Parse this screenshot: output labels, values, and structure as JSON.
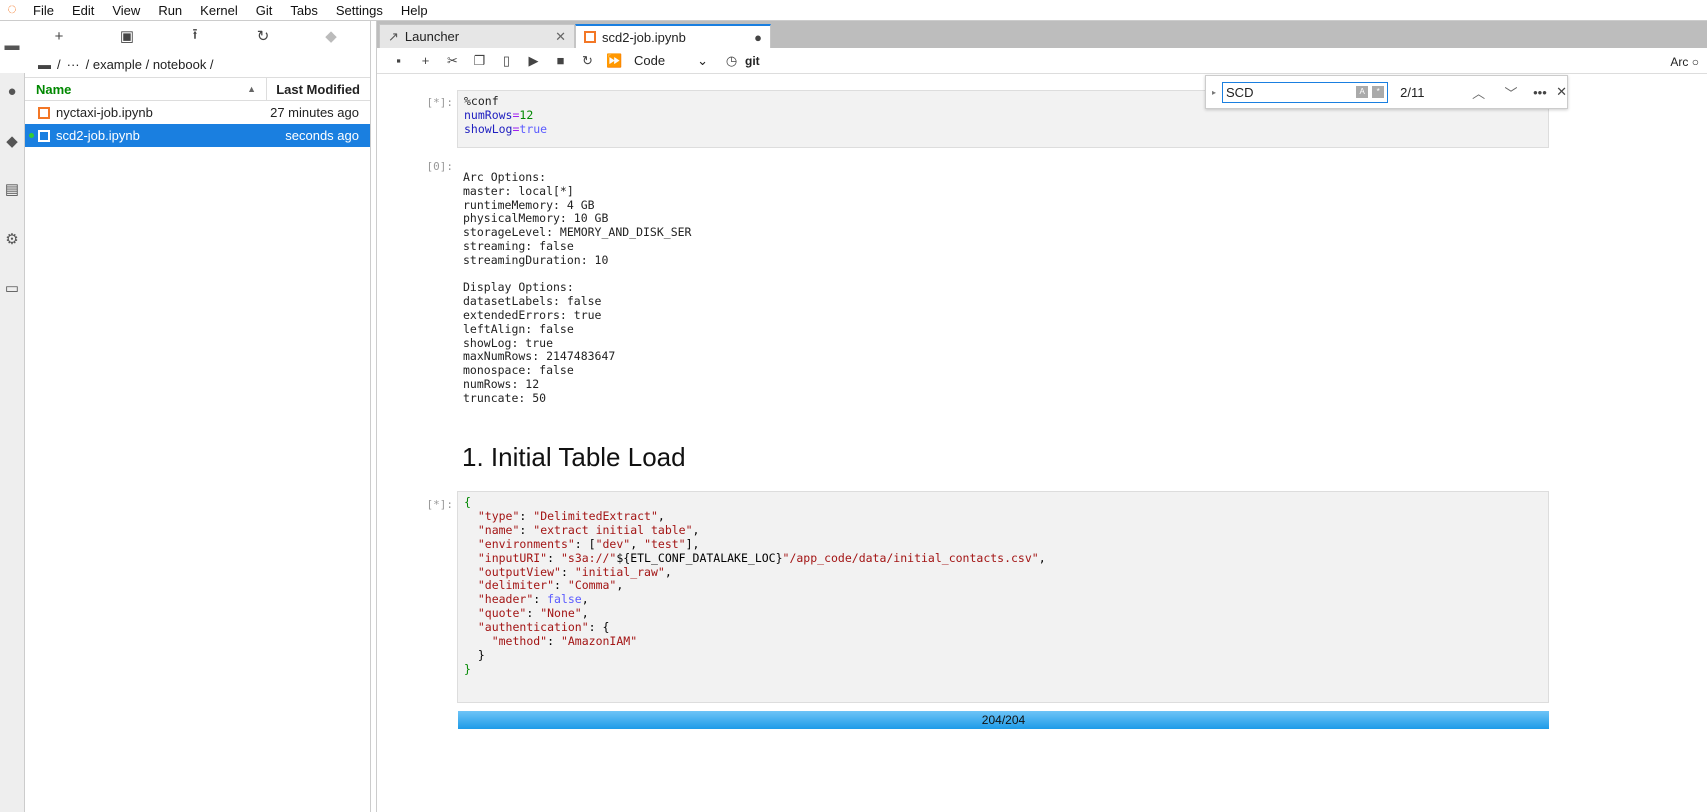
{
  "menubar": {
    "items": [
      "File",
      "Edit",
      "View",
      "Run",
      "Kernel",
      "Git",
      "Tabs",
      "Settings",
      "Help"
    ]
  },
  "filebrowser": {
    "breadcrumb": [
      "/",
      "···",
      "/ example / notebook /"
    ],
    "columns": {
      "name": "Name",
      "modified": "Last Modified"
    },
    "files": [
      {
        "name": "nyctaxi-job.ipynb",
        "modified": "27 minutes ago",
        "selected": false
      },
      {
        "name": "scd2-job.ipynb",
        "modified": "seconds ago",
        "selected": true
      }
    ]
  },
  "tabs": [
    {
      "label": "Launcher"
    },
    {
      "label": "scd2-job.ipynb"
    }
  ],
  "toolbar": {
    "cell_type": "Code",
    "git": "git",
    "kernel": "Arc"
  },
  "search": {
    "value": "SCD",
    "count": "2/11"
  },
  "cells": {
    "c1_prompt": "[*]:",
    "c1_code": {
      "l1": "%conf",
      "l2a": "numRows",
      "l2b": "=",
      "l2c": "12",
      "l3a": "showLog",
      "l3b": "=",
      "l3c": "true"
    },
    "o1_prompt": "[0]:",
    "o1_text": "Arc Options:\nmaster: local[*]\nruntimeMemory: 4 GB\nphysicalMemory: 10 GB\nstorageLevel: MEMORY_AND_DISK_SER\nstreaming: false\nstreamingDuration: 10\n\nDisplay Options:\ndatasetLabels: false\nextendedErrors: true\nleftAlign: false\nshowLog: true\nmaxNumRows: 2147483647\nmonospace: false\nnumRows: 12\ntruncate: 50",
    "heading": "1. Initial Table Load",
    "c2_prompt": "[*]:",
    "c2_lines": [
      [
        [
          "g",
          "{"
        ]
      ],
      [
        [
          "p",
          "  "
        ],
        [
          "s",
          "\"type\""
        ],
        [
          "p",
          ": "
        ],
        [
          "s",
          "\"DelimitedExtract\""
        ],
        [
          "p",
          ","
        ]
      ],
      [
        [
          "p",
          "  "
        ],
        [
          "s",
          "\"name\""
        ],
        [
          "p",
          ": "
        ],
        [
          "s",
          "\"extract initial table\""
        ],
        [
          "p",
          ","
        ]
      ],
      [
        [
          "p",
          "  "
        ],
        [
          "s",
          "\"environments\""
        ],
        [
          "p",
          ": ["
        ],
        [
          "s",
          "\"dev\""
        ],
        [
          "p",
          ", "
        ],
        [
          "s",
          "\"test\""
        ],
        [
          "p",
          "],"
        ]
      ],
      [
        [
          "p",
          "  "
        ],
        [
          "s",
          "\"inputURI\""
        ],
        [
          "p",
          ": "
        ],
        [
          "s",
          "\"s3a://\""
        ],
        [
          "p",
          "${ETL_CONF_DATALAKE_LOC}"
        ],
        [
          "s",
          "\"/app_code/data/initial_contacts.csv\""
        ],
        [
          "p",
          ","
        ]
      ],
      [
        [
          "p",
          "  "
        ],
        [
          "s",
          "\"outputView\""
        ],
        [
          "p",
          ": "
        ],
        [
          "s",
          "\"initial_raw\""
        ],
        [
          "p",
          ","
        ]
      ],
      [
        [
          "p",
          "  "
        ],
        [
          "s",
          "\"delimiter\""
        ],
        [
          "p",
          ": "
        ],
        [
          "s",
          "\"Comma\""
        ],
        [
          "p",
          ","
        ]
      ],
      [
        [
          "p",
          "  "
        ],
        [
          "s",
          "\"header\""
        ],
        [
          "p",
          ": "
        ],
        [
          "b2",
          "false"
        ],
        [
          "p",
          ","
        ]
      ],
      [
        [
          "p",
          "  "
        ],
        [
          "s",
          "\"quote\""
        ],
        [
          "p",
          ": "
        ],
        [
          "s",
          "\"None\""
        ],
        [
          "p",
          ","
        ]
      ],
      [
        [
          "p",
          "  "
        ],
        [
          "s",
          "\"authentication\""
        ],
        [
          "p",
          ": {"
        ]
      ],
      [
        [
          "p",
          "    "
        ],
        [
          "s",
          "\"method\""
        ],
        [
          "p",
          ": "
        ],
        [
          "s",
          "\"AmazonIAM\""
        ]
      ],
      [
        [
          "p",
          "  }"
        ]
      ],
      [
        [
          "g",
          "}"
        ]
      ]
    ],
    "progress": "204/204",
    "progress_fraction": 1.0
  }
}
